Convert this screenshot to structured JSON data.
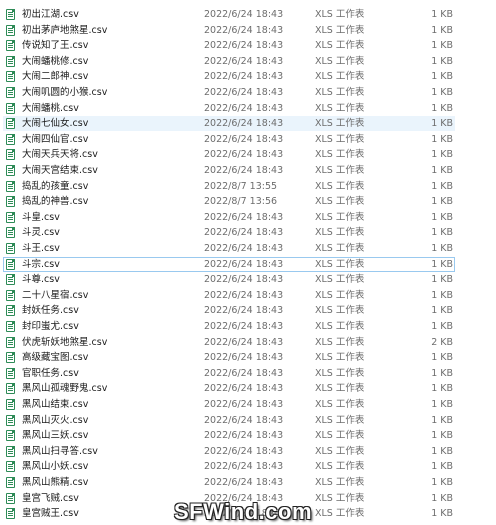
{
  "files": [
    {
      "name": "初出江湖.csv",
      "date": "2022/6/24 18:43",
      "type": "XLS 工作表",
      "size": "1 KB"
    },
    {
      "name": "初出茅庐地煞星.csv",
      "date": "2022/6/24 18:43",
      "type": "XLS 工作表",
      "size": "1 KB"
    },
    {
      "name": "传说知了王.csv",
      "date": "2022/6/24 18:43",
      "type": "XLS 工作表",
      "size": "1 KB"
    },
    {
      "name": "大闹蟠桃修.csv",
      "date": "2022/6/24 18:43",
      "type": "XLS 工作表",
      "size": "1 KB"
    },
    {
      "name": "大闹二郎神.csv",
      "date": "2022/6/24 18:43",
      "type": "XLS 工作表",
      "size": "1 KB"
    },
    {
      "name": "大闹叽圆的小猴.csv",
      "date": "2022/6/24 18:43",
      "type": "XLS 工作表",
      "size": "1 KB"
    },
    {
      "name": "大闹蟠桃.csv",
      "date": "2022/6/24 18:43",
      "type": "XLS 工作表",
      "size": "1 KB"
    },
    {
      "name": "大闹七仙女.csv",
      "date": "2022/6/24 18:43",
      "type": "XLS 工作表",
      "size": "1 KB"
    },
    {
      "name": "大闹四仙官.csv",
      "date": "2022/6/24 18:43",
      "type": "XLS 工作表",
      "size": "1 KB"
    },
    {
      "name": "大闹天兵天将.csv",
      "date": "2022/6/24 18:43",
      "type": "XLS 工作表",
      "size": "1 KB"
    },
    {
      "name": "大闹天宫结束.csv",
      "date": "2022/6/24 18:43",
      "type": "XLS 工作表",
      "size": "1 KB"
    },
    {
      "name": "捣乱的孩童.csv",
      "date": "2022/8/7 13:55",
      "type": "XLS 工作表",
      "size": "1 KB"
    },
    {
      "name": "捣乱的神兽.csv",
      "date": "2022/8/7 13:56",
      "type": "XLS 工作表",
      "size": "1 KB"
    },
    {
      "name": "斗皇.csv",
      "date": "2022/6/24 18:43",
      "type": "XLS 工作表",
      "size": "1 KB"
    },
    {
      "name": "斗灵.csv",
      "date": "2022/6/24 18:43",
      "type": "XLS 工作表",
      "size": "1 KB"
    },
    {
      "name": "斗王.csv",
      "date": "2022/6/24 18:43",
      "type": "XLS 工作表",
      "size": "1 KB"
    },
    {
      "name": "斗宗.csv",
      "date": "2022/6/24 18:43",
      "type": "XLS 工作表",
      "size": "1 KB"
    },
    {
      "name": "斗尊.csv",
      "date": "2022/6/24 18:43",
      "type": "XLS 工作表",
      "size": "1 KB"
    },
    {
      "name": "二十八星宿.csv",
      "date": "2022/6/24 18:43",
      "type": "XLS 工作表",
      "size": "1 KB"
    },
    {
      "name": "封妖任务.csv",
      "date": "2022/6/24 18:43",
      "type": "XLS 工作表",
      "size": "1 KB"
    },
    {
      "name": "封印蚩尤.csv",
      "date": "2022/6/24 18:43",
      "type": "XLS 工作表",
      "size": "1 KB"
    },
    {
      "name": "伏虎斩妖地煞星.csv",
      "date": "2022/6/24 18:43",
      "type": "XLS 工作表",
      "size": "2 KB"
    },
    {
      "name": "高级藏宝图.csv",
      "date": "2022/6/24 18:43",
      "type": "XLS 工作表",
      "size": "1 KB"
    },
    {
      "name": "官职任务.csv",
      "date": "2022/6/24 18:43",
      "type": "XLS 工作表",
      "size": "1 KB"
    },
    {
      "name": "黑风山孤魂野鬼.csv",
      "date": "2022/6/24 18:43",
      "type": "XLS 工作表",
      "size": "1 KB"
    },
    {
      "name": "黑风山结束.csv",
      "date": "2022/6/24 18:43",
      "type": "XLS 工作表",
      "size": "1 KB"
    },
    {
      "name": "黑风山灭火.csv",
      "date": "2022/6/24 18:43",
      "type": "XLS 工作表",
      "size": "1 KB"
    },
    {
      "name": "黑风山三妖.csv",
      "date": "2022/6/24 18:43",
      "type": "XLS 工作表",
      "size": "1 KB"
    },
    {
      "name": "黑风山扫寻答.csv",
      "date": "2022/6/24 18:43",
      "type": "XLS 工作表",
      "size": "1 KB"
    },
    {
      "name": "黑风山小妖.csv",
      "date": "2022/6/24 18:43",
      "type": "XLS 工作表",
      "size": "1 KB"
    },
    {
      "name": "黑风山熊精.csv",
      "date": "2022/6/24 18:43",
      "type": "XLS 工作表",
      "size": "1 KB"
    },
    {
      "name": "皇宫飞贼.csv",
      "date": "2022/6/24 18:43",
      "type": "XLS 工作表",
      "size": "1 KB"
    },
    {
      "name": "皇宫贼王.csv",
      "date": "2022/6/24 18:43",
      "type": "XLS 工作表",
      "size": "1 KB"
    }
  ],
  "selected_index": 7,
  "focused_index": 16,
  "watermark": "SFWind.com"
}
